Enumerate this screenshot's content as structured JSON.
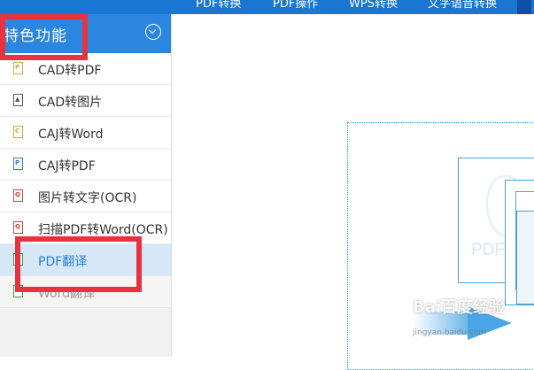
{
  "topnav": {
    "tabs": [
      {
        "label": "PDF转换"
      },
      {
        "label": "PDF操作"
      },
      {
        "label": "WPS转换"
      },
      {
        "label": "文字语音转换"
      }
    ]
  },
  "sidebar": {
    "header": {
      "title": "特色功能"
    },
    "items": [
      {
        "label": "CAD转PDF",
        "icon": "pdf-file-icon",
        "glyph": "P",
        "glyph_color": "#c8a84a"
      },
      {
        "label": "CAD转图片",
        "icon": "image-file-icon",
        "glyph": "▲",
        "glyph_color": "#555555"
      },
      {
        "label": "CAJ转Word",
        "icon": "caj-file-icon",
        "glyph": "C",
        "glyph_color": "#c8a84a"
      },
      {
        "label": "CAJ转PDF",
        "icon": "pdf-file-icon",
        "glyph": "P",
        "glyph_color": "#3a7ac8"
      },
      {
        "label": "图片转文字(OCR)",
        "icon": "ocr-icon",
        "glyph": "Q",
        "glyph_color": "#c04848"
      },
      {
        "label": "扫描PDF转Word(OCR)",
        "icon": "scan-icon",
        "glyph": "Q",
        "glyph_color": "#c04848"
      },
      {
        "label": "PDF翻译",
        "icon": "translate-icon",
        "glyph": "P",
        "glyph_color": "#3aa048",
        "active": true
      },
      {
        "label": "Word翻译",
        "icon": "word-translate-icon",
        "glyph": "W",
        "glyph_color": "#3aa048",
        "faded": true
      }
    ]
  },
  "main": {
    "illustration_text": "PDF",
    "watermark": "Bai百度经验",
    "watermark_sub": "jingyan.baidu.com"
  },
  "colors": {
    "nav": "#1976d2",
    "header": "#2b86e0",
    "accent": "#2a7fd4",
    "annotation": "#e8323f"
  }
}
